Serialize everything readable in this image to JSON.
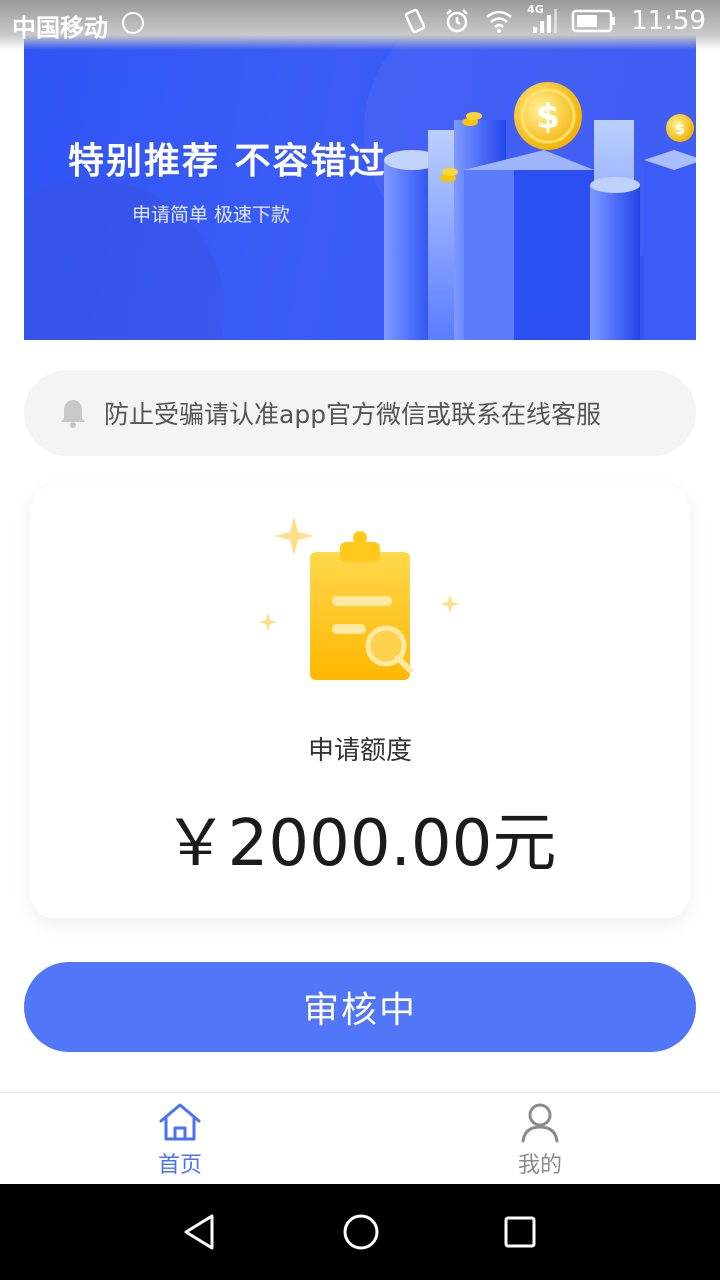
{
  "status_bar": {
    "carrier": "中国移动",
    "network": "4G",
    "time": "11:59"
  },
  "banner": {
    "title": "特别推荐 不容错过",
    "subtitle": "申请简单 极速下款",
    "coin_symbol": "$"
  },
  "notice": {
    "icon": "bell-icon",
    "text": "防止受骗请认准app官方微信或联系在线客服"
  },
  "card": {
    "icon": "clipboard-search-icon",
    "label": "申请额度",
    "amount": "￥2000.00元"
  },
  "action_button": {
    "label": "审核中"
  },
  "tab_bar": {
    "items": [
      {
        "label": "首页",
        "icon": "home-icon",
        "active": true
      },
      {
        "label": "我的",
        "icon": "user-icon",
        "active": false
      }
    ]
  },
  "colors": {
    "brand_blue": "#5176f7",
    "banner_blue": "#3355ef",
    "active_tab": "#4a72f3",
    "inactive_tab": "#8a8a8a",
    "notice_bg": "#f4f4f4"
  }
}
